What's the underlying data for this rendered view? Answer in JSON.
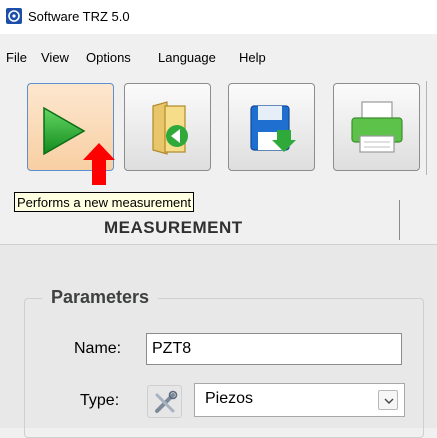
{
  "window": {
    "title": "Software TRZ 5.0",
    "icon": "trz-app-icon"
  },
  "menu": [
    {
      "label": "File"
    },
    {
      "label": "View"
    },
    {
      "label": "Options"
    },
    {
      "label": "Language"
    },
    {
      "label": "Help"
    }
  ],
  "toolbar": {
    "buttons": [
      {
        "name": "new-measurement",
        "icon": "play-icon",
        "state": "hover"
      },
      {
        "name": "open",
        "icon": "folder-open-icon"
      },
      {
        "name": "save",
        "icon": "save-icon"
      },
      {
        "name": "print",
        "icon": "printer-icon"
      }
    ]
  },
  "tooltip": {
    "text": "Performs a new measurement"
  },
  "tabs": [
    {
      "label": "MEASUREMENT",
      "partially_obscured": true
    }
  ],
  "parameters": {
    "title": "Parameters",
    "name_label": "Name:",
    "name_value": "PZT8",
    "type_label": "Type:",
    "type_value": "Piezos",
    "type_icon": "tools-icon"
  },
  "colors": {
    "hover_button": "#f8cfa3",
    "tooltip_bg": "#ffffe1",
    "arrow": "#ff0000"
  }
}
